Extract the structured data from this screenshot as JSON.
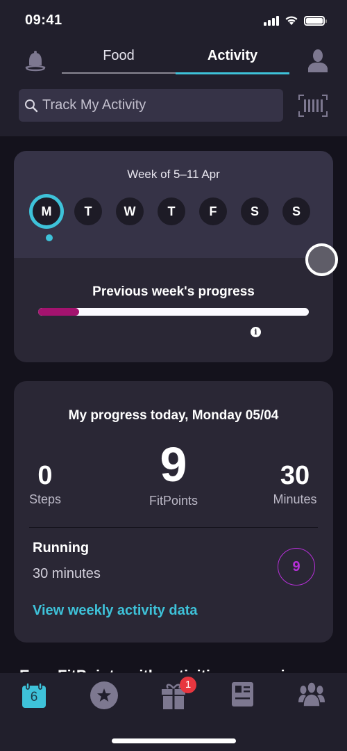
{
  "status_bar": {
    "time": "09:41"
  },
  "header": {
    "tabs": [
      {
        "label": "Food",
        "active": false
      },
      {
        "label": "Activity",
        "active": true
      }
    ],
    "search": {
      "placeholder": "Track My Activity",
      "value": ""
    },
    "icons": {
      "left": "bell-icon",
      "right": "profile-icon",
      "scan": "barcode-scan-icon"
    }
  },
  "week_card": {
    "title": "Week of 5–11 Apr",
    "days": [
      "M",
      "T",
      "W",
      "T",
      "F",
      "S",
      "S"
    ],
    "selected_day_index": 0,
    "previous_week": {
      "title": "Previous week's progress",
      "progress_percent": 15,
      "info_glyph": "i"
    }
  },
  "today_card": {
    "title": "My progress today, Monday 05/04",
    "stats": {
      "steps": {
        "value": "0",
        "label": "Steps"
      },
      "fitpoints": {
        "value": "9",
        "label": "FitPoints"
      },
      "minutes": {
        "value": "30",
        "label": "Minutes"
      }
    },
    "activity": {
      "name": "Running",
      "duration": "30 minutes",
      "points": "9"
    },
    "link": "View weekly activity data"
  },
  "peek_heading": "Earn FitPoints with activities you enjoy",
  "bottom_nav": {
    "items": [
      {
        "name": "calendar",
        "icon": "calendar-icon",
        "day": "6",
        "active": true
      },
      {
        "name": "star",
        "icon": "star-icon",
        "active": false
      },
      {
        "name": "rewards",
        "icon": "gift-icon",
        "badge": "1",
        "active": false
      },
      {
        "name": "articles",
        "icon": "newspaper-icon",
        "active": false
      },
      {
        "name": "community",
        "icon": "group-icon",
        "active": false
      }
    ]
  },
  "colors": {
    "accent": "#3ec2d9",
    "progress_fill": "#a4136f",
    "points": "#b730d9",
    "badge": "#e8363f",
    "icon_muted": "#7d7890"
  }
}
